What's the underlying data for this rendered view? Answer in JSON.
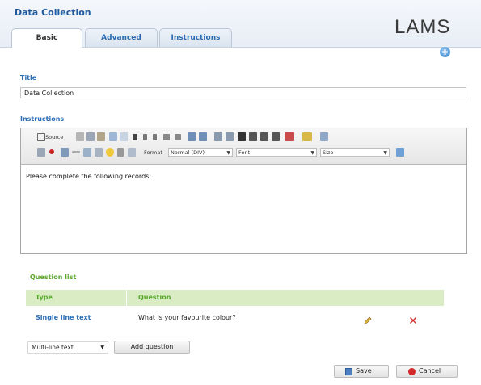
{
  "app": {
    "title": "Data Collection",
    "logo": "LAMS"
  },
  "tabs": [
    {
      "label": "Basic",
      "active": true
    },
    {
      "label": "Advanced",
      "active": false
    },
    {
      "label": "Instructions",
      "active": false
    }
  ],
  "fields": {
    "title_label": "Title",
    "title_value": "Data Collection",
    "instructions_label": "Instructions",
    "instructions_text": "Please complete the following records:"
  },
  "toolbar": {
    "source": "Source",
    "format_label": "Format",
    "format_value": "Normal (DIV)",
    "font_value": "Font",
    "size_value": "Size"
  },
  "questions": {
    "label": "Question list",
    "headers": {
      "type": "Type",
      "question": "Question"
    },
    "rows": [
      {
        "type": "Single line text",
        "question": "What is your favourite colour?"
      }
    ],
    "type_select": "Multi-line text",
    "add_button": "Add question"
  },
  "actions": {
    "save": "Save",
    "cancel": "Cancel"
  },
  "colors": {
    "accent": "#2a6db5",
    "green": "#5aa82c",
    "header_bg": "#e8eef6"
  },
  "icons": [
    "help-icon",
    "edit-icon",
    "delete-icon",
    "save-icon",
    "cancel-icon"
  ]
}
